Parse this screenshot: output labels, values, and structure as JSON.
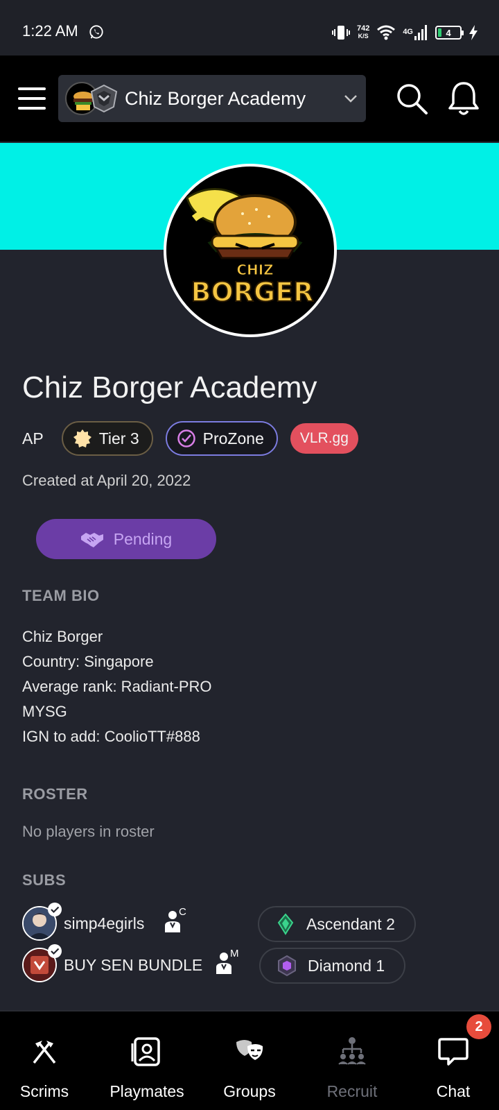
{
  "status_bar": {
    "time": "1:22 AM",
    "net_speed_value": "742",
    "net_speed_unit": "K/S",
    "network": "4G",
    "battery": "4"
  },
  "header": {
    "team_select": "Chiz Borger Academy"
  },
  "team": {
    "name": "Chiz Borger Academy",
    "logo_text_top": "CHIZ",
    "logo_text_bottom": "BORGER",
    "region": "AP",
    "tier": "Tier 3",
    "prozone": "ProZone",
    "vlr": "VLR.gg",
    "created": "Created at April 20, 2022",
    "pending_label": "Pending"
  },
  "sections": {
    "bio_title": "TEAM BIO",
    "roster_title": "ROSTER",
    "subs_title": "SUBS"
  },
  "bio_lines": [
    "Chiz Borger",
    "Country: Singapore",
    "Average rank: Radiant-PRO",
    "MYSG",
    "IGN to add: CoolioTT#888"
  ],
  "roster": {
    "empty": "No players in roster"
  },
  "subs": [
    {
      "name": "simp4egirls",
      "role": "C",
      "rank": "Ascendant 2"
    },
    {
      "name": "BUY SEN BUNDLE",
      "role": "M",
      "rank": "Diamond 1"
    }
  ],
  "nav": {
    "items": [
      {
        "label": "Scrims"
      },
      {
        "label": "Playmates"
      },
      {
        "label": "Groups"
      },
      {
        "label": "Recruit"
      },
      {
        "label": "Chat"
      }
    ],
    "chat_badge": "2"
  },
  "colors": {
    "banner": "#00f0e6",
    "pending": "#6b3da6",
    "vlr": "#e3505e",
    "badge": "#e74c3c"
  }
}
